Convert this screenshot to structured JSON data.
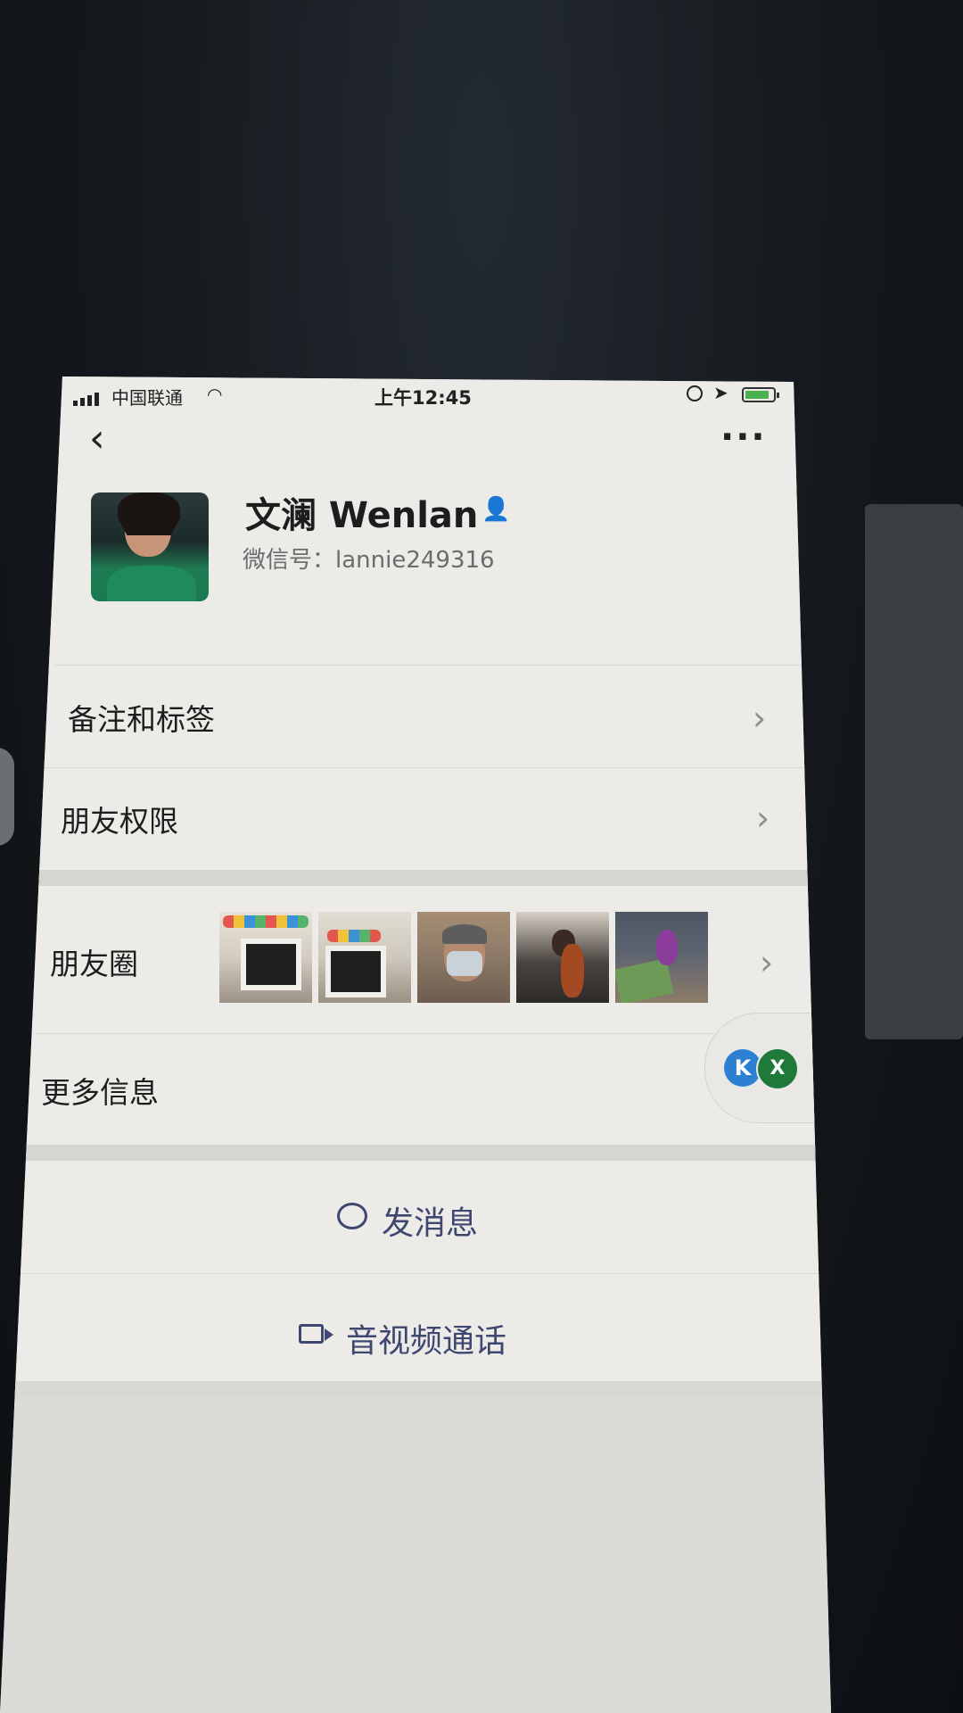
{
  "status_bar": {
    "carrier": "中国联通",
    "time": "上午12:45"
  },
  "nav": {
    "back_icon": "chevron-left-icon",
    "more_icon": "ellipsis-icon"
  },
  "profile": {
    "name": "文澜 Wenlan",
    "wechat_id": "微信号：lannie249316",
    "badge_icon": "user-icon"
  },
  "rows": {
    "remarks_tags": "备注和标签",
    "friend_permissions": "朋友权限",
    "moments": "朋友圈",
    "more_info": "更多信息"
  },
  "floating_badges": {
    "a": "K",
    "b": "X"
  },
  "actions": {
    "send_message": "发消息",
    "video_call": "音视频通话"
  },
  "colors": {
    "action_text": "#3e4770",
    "badge_user": "#d9574c"
  }
}
